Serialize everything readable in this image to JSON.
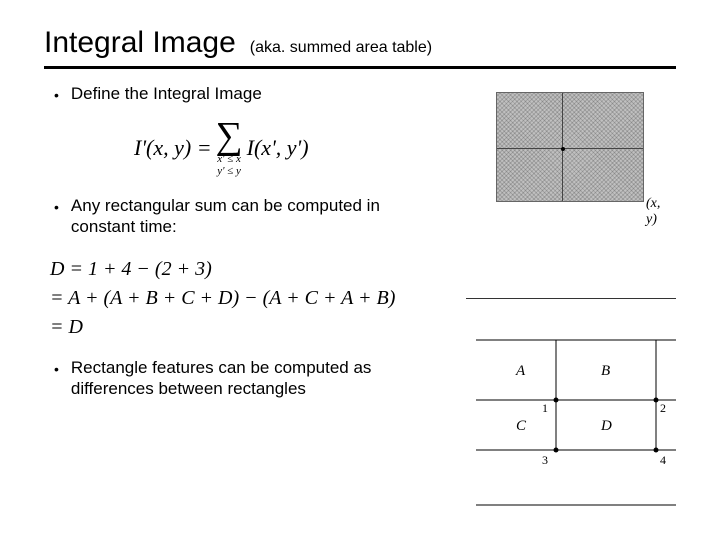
{
  "title": "Integral Image",
  "subtitle": "(aka. summed area table)",
  "bullets": {
    "b1": "Define the Integral Image",
    "b2": "Any rectangular sum can be computed in constant time:",
    "b3": "Rectangle features can be computed as differences between rectangles"
  },
  "formula1": {
    "lhs": "I'(x, y) =",
    "sum_sub1": "x' ≤ x",
    "sum_sub2": "y' ≤ y",
    "rhs": "I(x', y')"
  },
  "formula2": {
    "line1": "D = 1 + 4 − (2 + 3)",
    "line2": "= A + (A + B + C + D) − (A + C + A + B)",
    "line3": "= D"
  },
  "fig1": {
    "label": "(x, y)"
  },
  "fig2": {
    "A": "A",
    "B": "B",
    "C": "C",
    "D": "D",
    "p1": "1",
    "p2": "2",
    "p3": "3",
    "p4": "4"
  }
}
